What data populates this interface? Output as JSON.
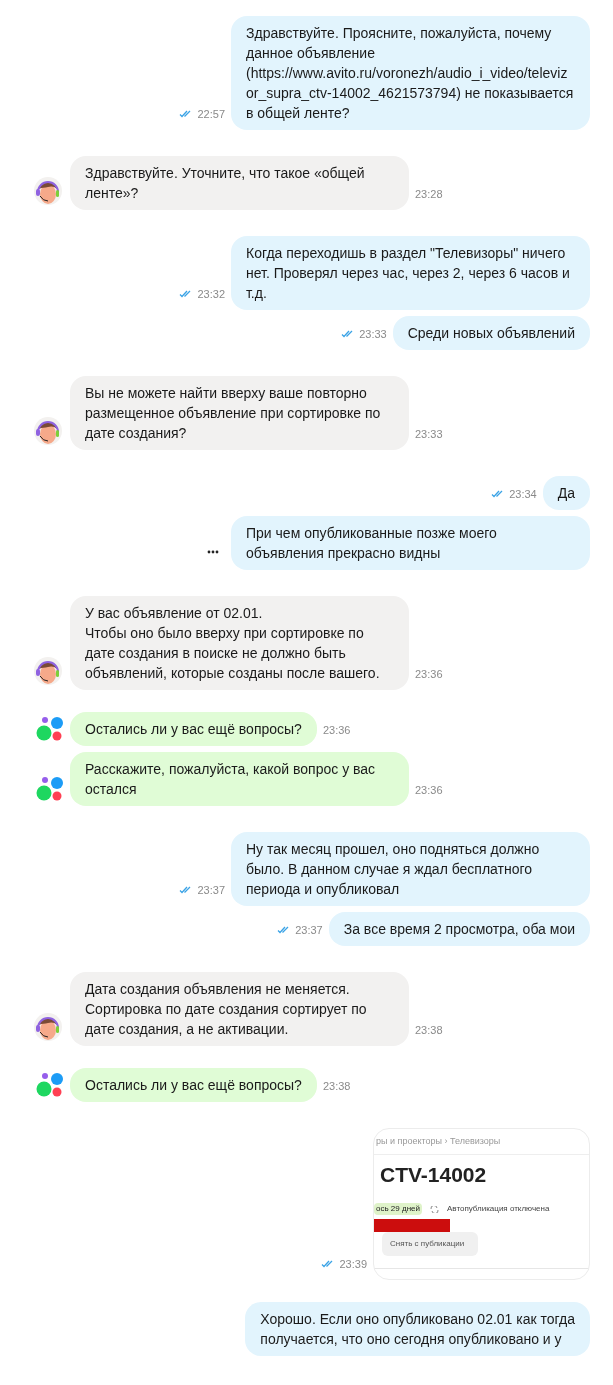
{
  "messages": [
    {
      "kind": "out",
      "read": true,
      "time": "22:57",
      "text": "Здравствуйте. Проясните, пожалуйста, почему данное объявление (https://www.avito.ru/voronezh/audio_i_video/televizor_supra_ctv-14002_4621573794) не показывается в общей ленте?"
    },
    {
      "kind": "agent",
      "time": "23:28",
      "text": "Здравствуйте. Уточните, что такое «общей ленте»?"
    },
    {
      "kind": "out",
      "read": true,
      "time": "23:32",
      "text": "Когда переходишь в раздел \"Телевизоры\" ничего нет. Проверял через час, через 2, через 6 часов и т.д."
    },
    {
      "kind": "out",
      "read": true,
      "time": "23:33",
      "text": "Среди новых объявлений"
    },
    {
      "kind": "agent",
      "time": "23:33",
      "text": "Вы не можете найти вверху ваше повторно размещенное объявление при сортировке по дате создания?"
    },
    {
      "kind": "out",
      "read": true,
      "time": "23:34",
      "text": "Да"
    },
    {
      "kind": "out",
      "sending": true,
      "text": "При чем опубликованные позже моего объявления прекрасно видны"
    },
    {
      "kind": "agent",
      "time": "23:36",
      "text": "У вас объявление от 02.01.\nЧтобы оно было вверху при сортировке по дате создания в поиске не должно быть объявлений, которые созданы после вашего."
    },
    {
      "kind": "bot",
      "time": "23:36",
      "text": "Остались ли у вас ещё вопросы?"
    },
    {
      "kind": "bot",
      "time": "23:36",
      "text": "Расскажите, пожалуйста, какой вопрос у вас остался"
    },
    {
      "kind": "out",
      "read": true,
      "time": "23:37",
      "text": "Ну так месяц прошел, оно подняться должно было. В данном случае я ждал бесплатного периода и опубликовал"
    },
    {
      "kind": "out",
      "read": true,
      "time": "23:37",
      "text": "За все время 2 просмотра, оба мои"
    },
    {
      "kind": "agent",
      "time": "23:38",
      "text": "Дата создания объявления не меняется.\nСортировка по дате создания сортирует по дате создания, а не активации."
    },
    {
      "kind": "bot",
      "time": "23:38",
      "text": "Остались ли у вас ещё вопросы?"
    },
    {
      "kind": "screenshot",
      "read": true,
      "time": "23:39",
      "breadcrumb": "ры и проекторы › Телевизоры",
      "title": "CTV-14002",
      "badge": "ось 29 дней",
      "autopublish": "Автопубликация отключена",
      "button": "Снять с публикации"
    },
    {
      "kind": "out",
      "text": "Хорошо. Если оно опубликовано 02.01 как тогда\nполучается, что оно сегодня опубликовано и у"
    }
  ]
}
